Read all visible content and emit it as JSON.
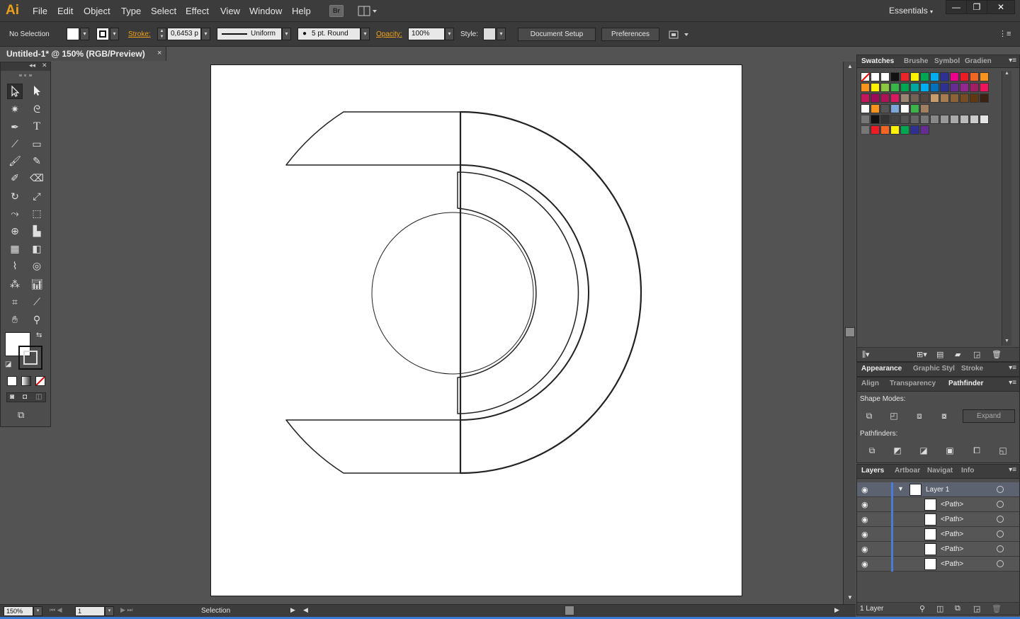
{
  "app": {
    "logo": "Ai"
  },
  "menu": [
    "File",
    "Edit",
    "Object",
    "Type",
    "Select",
    "Effect",
    "View",
    "Window",
    "Help"
  ],
  "menu_underline": [
    "F",
    "E",
    "O",
    "T",
    "S",
    "C",
    "V",
    "W",
    "H"
  ],
  "workspace": "Essentials",
  "bridge_label": "Br",
  "window_buttons": [
    "—",
    "❐",
    "✕"
  ],
  "control": {
    "selection_status": "No Selection",
    "stroke_label": "Stroke:",
    "stroke_value": "0,6453 p",
    "stroke_profile": "Uniform",
    "brush": "5 pt. Round",
    "opacity_label": "Opacity:",
    "opacity_value": "100%",
    "style_label": "Style:",
    "document_setup": "Document Setup",
    "preferences": "Preferences"
  },
  "document": {
    "tab_title": "Untitled-1* @ 150% (RGB/Preview)",
    "close": "×"
  },
  "status": {
    "zoom": "150%",
    "artboard": "1",
    "tool": "Selection"
  },
  "panels": {
    "swatches_tabs": [
      "Swatches",
      "Brushe",
      "Symbol",
      "Gradien"
    ],
    "appearance_tabs": [
      "Appearance",
      "Graphic Styl",
      "Stroke"
    ],
    "pathfinder_tabs": [
      "Align",
      "Transparency",
      "Pathfinder"
    ],
    "shape_modes_label": "Shape Modes:",
    "pathfinders_label": "Pathfinders:",
    "expand": "Expand",
    "layers_tabs": [
      "Layers",
      "Artboar",
      "Navigat",
      "Info"
    ],
    "layers": [
      {
        "name": "Layer 1"
      },
      {
        "name": "<Path>"
      },
      {
        "name": "<Path>"
      },
      {
        "name": "<Path>"
      },
      {
        "name": "<Path>"
      },
      {
        "name": "<Path>"
      }
    ],
    "layer_count": "1 Layer"
  },
  "swatch_rows": [
    [
      "#ffffff",
      "#ffffff",
      "#ffffff",
      "#111111",
      "#e8262a",
      "#fff200",
      "#00a651",
      "#00aeef",
      "#2e3192",
      "#ec008c",
      "#ed1c24",
      "#f26522",
      "#f7941d"
    ],
    [
      "#f7941d",
      "#fff200",
      "#8dc63f",
      "#39b54a",
      "#00a651",
      "#00a99d",
      "#00aeef",
      "#0072bc",
      "#2e3192",
      "#662d91",
      "#92278f",
      "#9e1f63",
      "#ed145b"
    ],
    [
      "#c2185b",
      "#9e0b5b",
      "#ad1457",
      "#d81b60",
      "#998675",
      "#736357",
      "#534741",
      "#c69c6d",
      "#a67c52",
      "#8c6239",
      "#754c24",
      "#603913",
      "#3b2314"
    ],
    [
      "#ffffff",
      "#f7941d",
      "#555555",
      "#7da7d9",
      "#ffffff",
      "#3cb44b",
      "#a08060"
    ],
    [
      "#111111",
      "#333333",
      "#444444",
      "#555555",
      "#666666",
      "#777777",
      "#888888",
      "#999999",
      "#aaaaaa",
      "#bbbbbb",
      "#cccccc",
      "#e6e6e6"
    ],
    [
      "#ed1c24",
      "#f26522",
      "#fff200",
      "#00a651",
      "#2e3192",
      "#662d91"
    ]
  ]
}
